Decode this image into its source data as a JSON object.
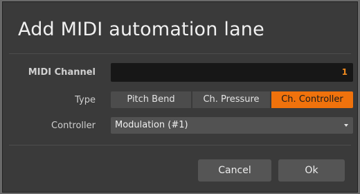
{
  "dialog": {
    "title": "Add MIDI automation lane"
  },
  "fields": {
    "midi_channel": {
      "label": "MIDI Channel",
      "value": "1"
    },
    "type": {
      "label": "Type",
      "options": [
        "Pitch Bend",
        "Ch. Pressure",
        "Ch. Controller"
      ],
      "selected": "Ch. Controller"
    },
    "controller": {
      "label": "Controller",
      "value": "Modulation (#1)"
    }
  },
  "buttons": {
    "cancel": "Cancel",
    "ok": "Ok"
  },
  "colors": {
    "accent": "#f0720c",
    "value_text": "#f08a1e"
  },
  "icons": {
    "dropdown": "chevron-down-icon"
  }
}
